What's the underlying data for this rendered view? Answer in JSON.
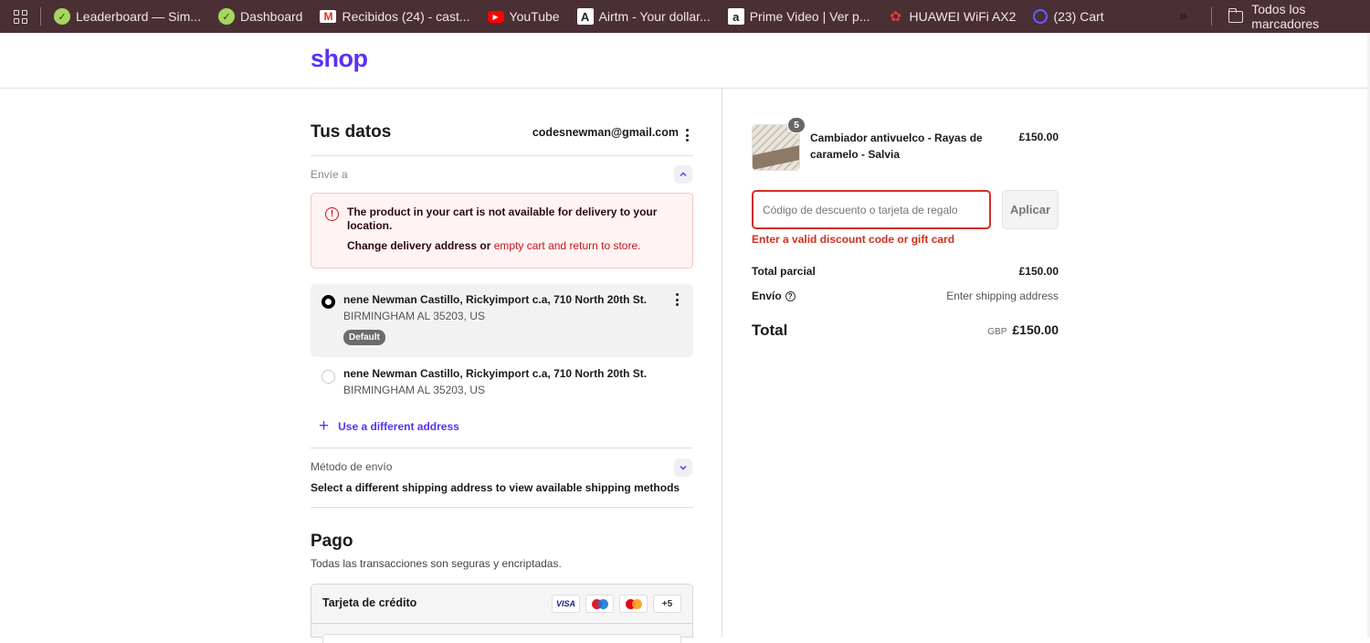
{
  "bookmarks": [
    {
      "label": "Leaderboard — Sim...",
      "icon": "leaderboard-favicon"
    },
    {
      "label": "Dashboard",
      "icon": "dashboard-favicon"
    },
    {
      "label": "Recibidos (24) - cast...",
      "icon": "gmail-favicon"
    },
    {
      "label": "YouTube",
      "icon": "youtube-favicon"
    },
    {
      "label": "Airtm - Your dollar...",
      "icon": "airtm-favicon"
    },
    {
      "label": "Prime Video | Ver p...",
      "icon": "amazon-favicon"
    },
    {
      "label": "HUAWEI WiFi AX2",
      "icon": "huawei-favicon"
    },
    {
      "label": "(23) Cart",
      "icon": "cart-favicon"
    }
  ],
  "bookmarks_folder": "Todos los marcadores",
  "brand": {
    "logo_text": "shop",
    "color": "#5a31f4"
  },
  "contact": {
    "title": "Tus datos",
    "email": "codesnewman@gmail.com"
  },
  "ship_to": {
    "label": "Envíe a",
    "alert": {
      "title": "The product in your cart is not available for delivery to your location.",
      "body_prefix": "Change delivery address or ",
      "body_link": "empty cart and return to store."
    },
    "addresses": [
      {
        "line1": "nene Newman Castillo, Rickyimport c.a, 710 North 20th St.",
        "line2": "BIRMINGHAM AL 35203, US",
        "badge": "Default",
        "selected": true
      },
      {
        "line1": "nene Newman Castillo, Rickyimport c.a, 710 North 20th St.",
        "line2": "BIRMINGHAM AL 35203, US",
        "selected": false
      }
    ],
    "add_address": "Use a different address"
  },
  "shipping_method": {
    "label": "Método de envío",
    "message": "Select a different shipping address to view available shipping methods"
  },
  "payment": {
    "title": "Pago",
    "subtitle": "Todas las transacciones son seguras y encriptadas.",
    "method_label": "Tarjeta de crédito",
    "brands": [
      "VISA",
      "maestro",
      "mastercard"
    ],
    "more_brands": "+5"
  },
  "order": {
    "item": {
      "name": "Cambiador antivuelco - Rayas de caramelo - Salvia",
      "price": "£150.00",
      "quantity": "5"
    },
    "discount": {
      "placeholder": "Código de descuento o tarjeta de regalo",
      "apply_label": "Aplicar",
      "error": "Enter a valid discount code or gift card"
    },
    "subtotal_label": "Total parcial",
    "subtotal_value": "£150.00",
    "shipping_label": "Envío",
    "shipping_value": "Enter shipping address",
    "total_label": "Total",
    "currency": "GBP",
    "total_value": "£150.00"
  },
  "colors": {
    "accent": "#5a31f4",
    "error": "#d22e1f",
    "bookmarks_bar": "#4a2f35"
  }
}
